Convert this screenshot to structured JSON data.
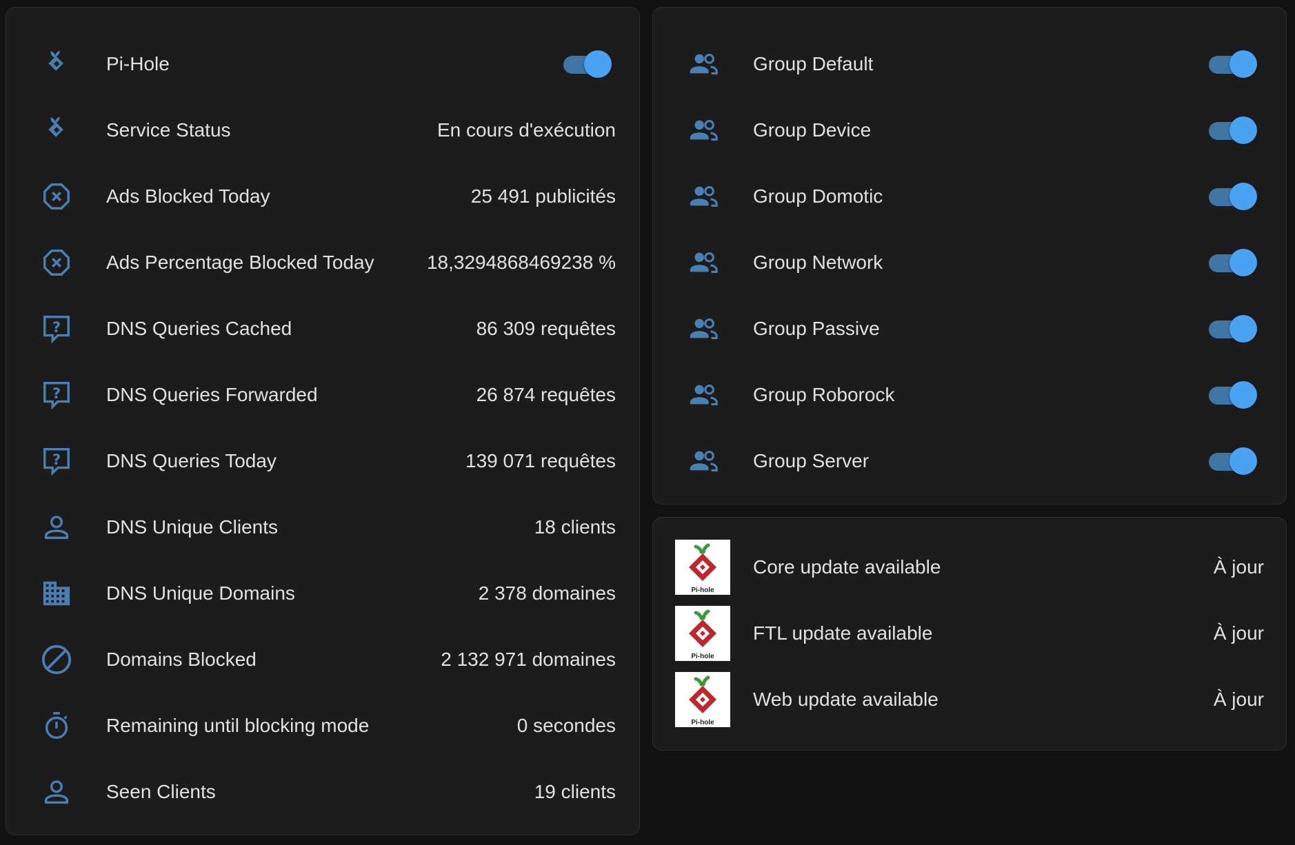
{
  "colors": {
    "background": "#111111",
    "card": "#1c1c1c",
    "icon": "#4a7fb5",
    "toggle_on": "#49a2f2",
    "text": "#e1e1e1"
  },
  "sensors": {
    "pihole": {
      "label": "Pi-Hole",
      "icon": "pihole-icon",
      "state": "on"
    },
    "rows": [
      {
        "label": "Service Status",
        "value": "En cours d'exécution",
        "icon": "pihole-icon"
      },
      {
        "label": "Ads Blocked Today",
        "value": "25 491 publicités",
        "icon": "close-octagon-icon"
      },
      {
        "label": "Ads Percentage Blocked Today",
        "value": "18,3294868469238 %",
        "icon": "close-octagon-icon"
      },
      {
        "label": "DNS Queries Cached",
        "value": "86 309 requêtes",
        "icon": "question-comment-icon"
      },
      {
        "label": "DNS Queries Forwarded",
        "value": "26 874 requêtes",
        "icon": "question-comment-icon"
      },
      {
        "label": "DNS Queries Today",
        "value": "139 071 requêtes",
        "icon": "question-comment-icon"
      },
      {
        "label": "DNS Unique Clients",
        "value": "18 clients",
        "icon": "account-icon"
      },
      {
        "label": "DNS Unique Domains",
        "value": "2 378 domaines",
        "icon": "domain-icon"
      },
      {
        "label": "Domains Blocked",
        "value": "2 132 971 domaines",
        "icon": "cancel-icon"
      },
      {
        "label": "Remaining until blocking mode",
        "value": "0 secondes",
        "icon": "timer-icon"
      },
      {
        "label": "Seen Clients",
        "value": "19 clients",
        "icon": "account-icon"
      }
    ]
  },
  "groups": [
    {
      "label": "Group Default",
      "icon": "account-group-icon",
      "state": "on"
    },
    {
      "label": "Group Device",
      "icon": "account-group-icon",
      "state": "on"
    },
    {
      "label": "Group Domotic",
      "icon": "account-group-icon",
      "state": "on"
    },
    {
      "label": "Group Network",
      "icon": "account-group-icon",
      "state": "on"
    },
    {
      "label": "Group Passive",
      "icon": "account-group-icon",
      "state": "on"
    },
    {
      "label": "Group Roborock",
      "icon": "account-group-icon",
      "state": "on"
    },
    {
      "label": "Group Server",
      "icon": "account-group-icon",
      "state": "on"
    }
  ],
  "updates": [
    {
      "label": "Core update available",
      "value": "À jour",
      "icon": "pihole-logo"
    },
    {
      "label": "FTL update available",
      "value": "À jour",
      "icon": "pihole-logo"
    },
    {
      "label": "Web update available",
      "value": "À jour",
      "icon": "pihole-logo"
    }
  ],
  "logo_text": "Pi-hole"
}
